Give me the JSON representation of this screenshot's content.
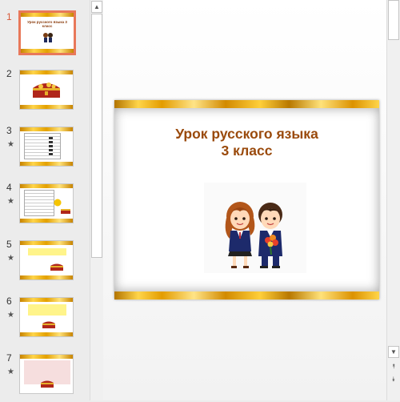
{
  "thumbnails": [
    {
      "number": "1",
      "star": "",
      "kind": "title",
      "title": "Урок русского языка 3 класс"
    },
    {
      "number": "2",
      "star": "",
      "kind": "chest"
    },
    {
      "number": "3",
      "star": "★",
      "kind": "table"
    },
    {
      "number": "4",
      "star": "★",
      "kind": "table-smile"
    },
    {
      "number": "5",
      "star": "★",
      "kind": "yellow-chest"
    },
    {
      "number": "6",
      "star": "★",
      "kind": "yellow-chest"
    },
    {
      "number": "7",
      "star": "★",
      "kind": "pink-chest"
    }
  ],
  "slide": {
    "title": "Урок русского языка\n3 класс"
  },
  "scrollbars": {
    "up_icon": "▲",
    "down_icon": "▼",
    "prev_slide_icon": "⯭",
    "next_slide_icon": "⯯"
  },
  "colors": {
    "accent_selection": "#e8785a",
    "title_color": "#9a4a0c",
    "gold": "#e3a000"
  }
}
